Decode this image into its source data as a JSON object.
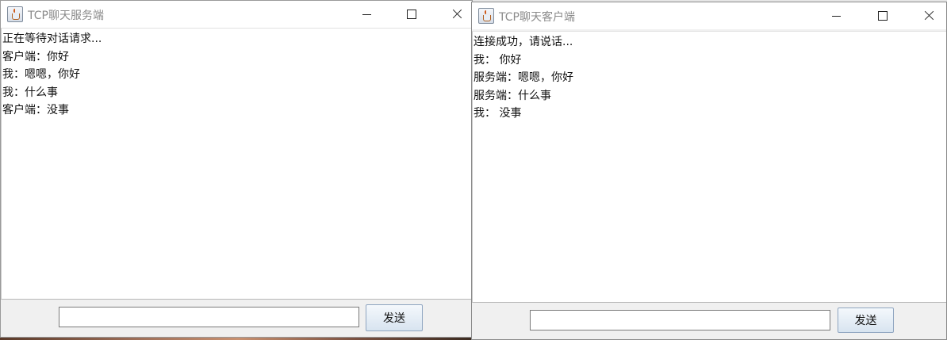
{
  "server_window": {
    "title": "TCP聊天服务端",
    "messages": [
      "正在等待对话请求...",
      "客户端：你好",
      "我：嗯嗯，你好",
      "我：什么事",
      "客户端：没事"
    ],
    "input_value": "",
    "send_label": "发送"
  },
  "client_window": {
    "title": "TCP聊天客户端",
    "messages": [
      "连接成功，请说话...",
      "我： 你好",
      "服务端：嗯嗯，你好",
      "服务端：什么事",
      "我： 没事"
    ],
    "input_value": "",
    "send_label": "发送"
  },
  "icons": {
    "app": "java-app-icon",
    "minimize": "minimize-icon",
    "maximize": "maximize-icon",
    "close": "close-icon"
  }
}
